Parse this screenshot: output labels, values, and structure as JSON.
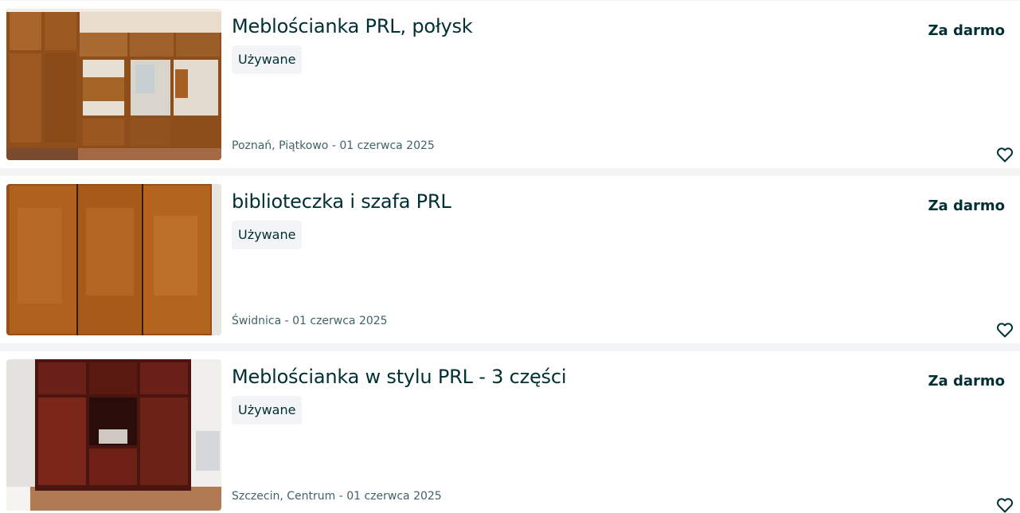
{
  "listings": [
    {
      "title": "Meblościanka PRL, połysk",
      "condition": "Używane",
      "location_date": "Poznań, Piątkowo - 01 czerwca 2025",
      "price": "Za darmo",
      "image": "wall-unit-photo",
      "favorite_icon": "heart-outline-icon"
    },
    {
      "title": "biblioteczka i szafa PRL",
      "condition": "Używane",
      "location_date": "Świdnica - 01 czerwca 2025",
      "price": "Za darmo",
      "image": "wardrobe-photo",
      "favorite_icon": "heart-outline-icon"
    },
    {
      "title": "Meblościanka w stylu PRL - 3 części",
      "condition": "Używane",
      "location_date": "Szczecin, Centrum - 01 czerwca 2025",
      "price": "Za darmo",
      "image": "dark-cabinet-photo",
      "favorite_icon": "heart-outline-icon"
    }
  ],
  "colors": {
    "text": "#002f34",
    "muted": "#406367",
    "badge_bg": "#f2f4f5",
    "page_bg": "#f2f4f5"
  }
}
